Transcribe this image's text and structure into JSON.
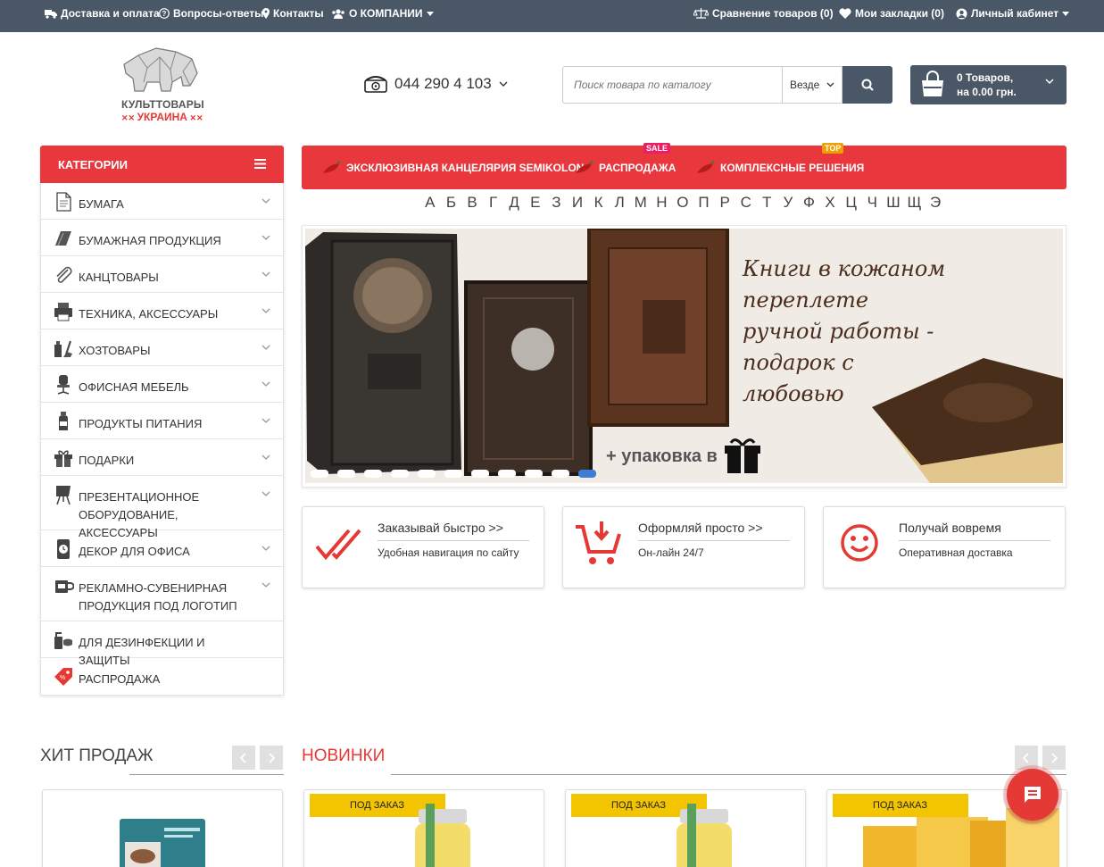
{
  "topbar": {
    "delivery": "Доставка и оплата",
    "faq": "Вопросы-ответы",
    "contacts": "Контакты",
    "about": "О КОМПАНИИ",
    "compare": "Сравнение товаров (0)",
    "bookmarks": "Мои закладки (0)",
    "account": "Личный кабинет"
  },
  "logo": {
    "line1": "КУЛЬТТОВАРЫ",
    "line2": "УКРАИНА"
  },
  "phone": {
    "number": "044 290 4 103"
  },
  "search": {
    "placeholder": "Поиск товара по каталогу",
    "scope": "Везде"
  },
  "cart": {
    "line1": "0 Товаров,",
    "line2": "на 0.00 грн."
  },
  "categories": {
    "title": "КАТЕГОРИИ",
    "items": [
      {
        "label": "Бумага"
      },
      {
        "label": "Бумажная продукция"
      },
      {
        "label": "Канцтовары"
      },
      {
        "label": "Техника, аксессуары"
      },
      {
        "label": "Хозтовары"
      },
      {
        "label": "Офисная мебель"
      },
      {
        "label": "Продукты питания"
      },
      {
        "label": "Подарки"
      },
      {
        "label": "Презентационное оборудование, аксессуары"
      },
      {
        "label": "Декор для офиса"
      },
      {
        "label": "Рекламно-сувенирная продукция под логотип"
      },
      {
        "label": "Для дезинфекции и защиты"
      },
      {
        "label": "Распродажа"
      }
    ]
  },
  "promo": {
    "items": [
      {
        "label": "ЭКСКЛЮЗИВНАЯ КАНЦЕЛЯРИЯ SEMIKOLON",
        "badge": ""
      },
      {
        "label": "РАСПРОДАЖА",
        "badge": "SALE"
      },
      {
        "label": "КОМПЛЕКСНЫЕ РЕШЕНИЯ",
        "badge": "TOP"
      }
    ]
  },
  "alphabet": [
    "А",
    "Б",
    "В",
    "Г",
    "Д",
    "Е",
    "З",
    "И",
    "К",
    "Л",
    "М",
    "Н",
    "О",
    "П",
    "Р",
    "С",
    "Т",
    "У",
    "Ф",
    "Х",
    "Ц",
    "Ч",
    "Ш",
    "Щ",
    "Э"
  ],
  "banner": {
    "headline": "Книги в кожаном\nпереплете\nручной работы -\nподарок с\nлюбовью",
    "subline": "+ упаковка в",
    "slides": 11,
    "active_slide": 11
  },
  "features": [
    {
      "title": "Заказывай быстро >>",
      "subtitle": "Удобная навигация по сайту",
      "icon": "double-check-icon"
    },
    {
      "title": "Оформляй просто >>",
      "subtitle": "Он-лайн 24/7",
      "icon": "cart-download-icon"
    },
    {
      "title": "Получай вовремя",
      "subtitle": "Оперативная доставка",
      "icon": "smiley-icon"
    }
  ],
  "sections": {
    "bestsellers": "ХИТ ПРОДАЖ",
    "new": "НОВИНКИ"
  },
  "products": [
    {
      "badge": ""
    },
    {
      "badge": "ПОД ЗАКАЗ"
    },
    {
      "badge": "ПОД ЗАКАЗ"
    },
    {
      "badge": "ПОД ЗАКАЗ"
    }
  ],
  "colors": {
    "accent": "#e8383d",
    "dark": "#4a5766",
    "badge": "#f2c500",
    "sale_badge": "#e91e63",
    "top_badge": "#f0a000"
  }
}
